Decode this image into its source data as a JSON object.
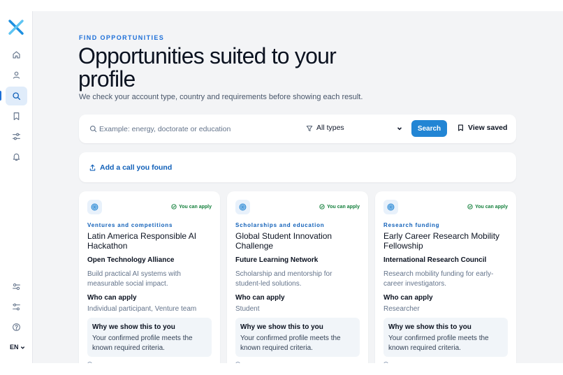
{
  "header": {
    "eyebrow": "FIND OPPORTUNITIES",
    "title": "Opportunities suited to your profile",
    "subtitle": "We check your account type, country and requirements before showing each result."
  },
  "sidebar": {
    "items": [
      {
        "icon": "home-icon",
        "active": false
      },
      {
        "icon": "user-icon",
        "active": false
      },
      {
        "icon": "search-icon",
        "active": true
      },
      {
        "icon": "bookmark-icon",
        "active": false
      },
      {
        "icon": "sliders-icon",
        "active": false
      },
      {
        "icon": "bell-icon",
        "active": false
      }
    ],
    "bottom_items": [
      {
        "icon": "settings-icon"
      },
      {
        "icon": "preferences-icon"
      },
      {
        "icon": "help-icon"
      }
    ],
    "language": "EN"
  },
  "search": {
    "placeholder": "Example: energy, doctorate or education",
    "value": "",
    "type_filter": "All types",
    "search_label": "Search",
    "view_saved_label": "View saved"
  },
  "add_call": {
    "label": "Add a call you found"
  },
  "opportunities": [
    {
      "category": "Ventures and competitions",
      "title": "Latin America Responsible AI Hackathon",
      "organization": "Open Technology Alliance",
      "description": "Build practical AI systems with measurable social impact.",
      "eligibility_badge": "You can apply",
      "who_label": "Who can apply",
      "who_value": "Individual participant, Venture team",
      "why_title": "Why we show this to you",
      "why_text": "Your confirmed profile meets the known required criteria."
    },
    {
      "category": "Scholarships and education",
      "title": "Global Student Innovation Challenge",
      "organization": "Future Learning Network",
      "description": "Scholarship and mentorship for student-led solutions.",
      "eligibility_badge": "You can apply",
      "who_label": "Who can apply",
      "who_value": "Student",
      "why_title": "Why we show this to you",
      "why_text": "Your confirmed profile meets the known required criteria."
    },
    {
      "category": "Research funding",
      "title": "Early Career Research Mobility Fellowship",
      "organization": "International Research Council",
      "description": "Research mobility funding for early-career investigators.",
      "eligibility_badge": "You can apply",
      "who_label": "Who can apply",
      "who_value": "Researcher",
      "why_title": "Why we show this to you",
      "why_text": "Your confirmed profile meets the known required criteria."
    }
  ],
  "colors": {
    "accent": "#2285d4",
    "accent_dark": "#0f5fb8",
    "success": "#15803d",
    "background": "#f3f4f6"
  }
}
